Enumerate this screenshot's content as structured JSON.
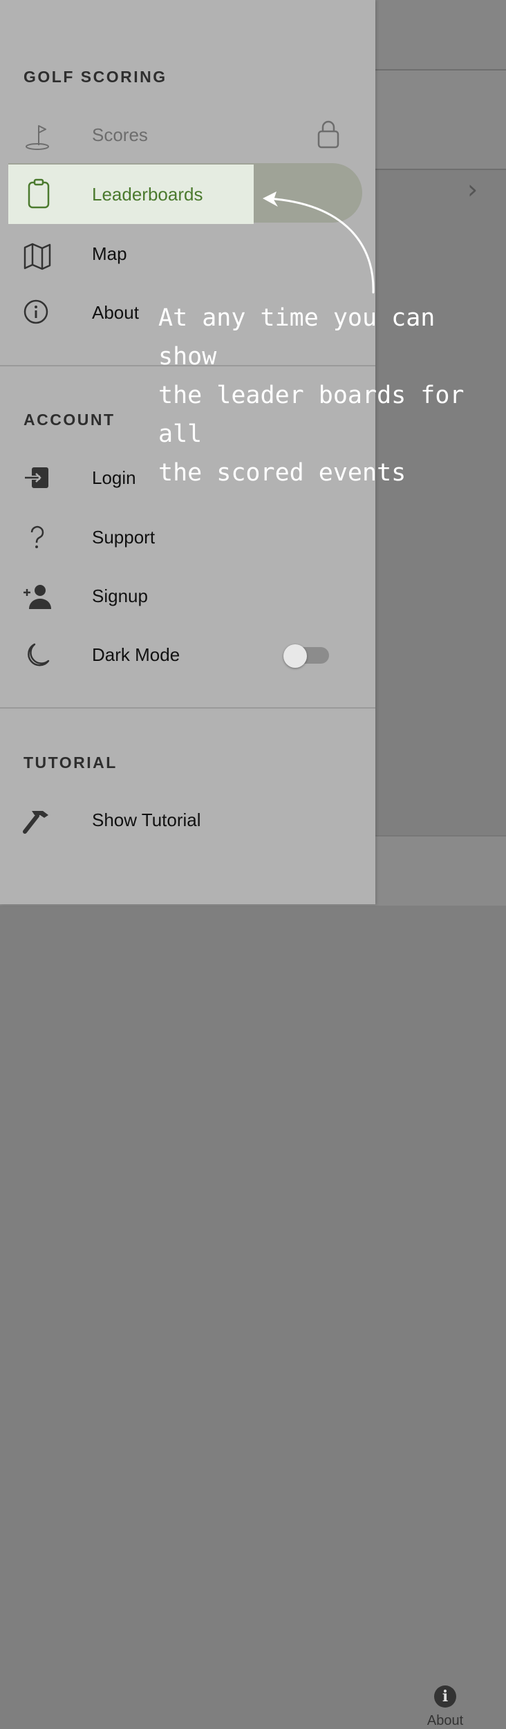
{
  "background_app": {
    "tabbar": {
      "about_label": "About"
    }
  },
  "drawer": {
    "sections": [
      {
        "title": "GOLF SCORING"
      },
      {
        "title": "ACCOUNT"
      },
      {
        "title": "TUTORIAL"
      }
    ],
    "golf_items": [
      {
        "label": "Scores",
        "icon": "flag-icon",
        "locked": true,
        "disabled": true
      },
      {
        "label": "Leaderboards",
        "icon": "clipboard-icon",
        "active": true
      },
      {
        "label": "Map",
        "icon": "map-icon"
      },
      {
        "label": "About",
        "icon": "info-icon"
      }
    ],
    "account_items": [
      {
        "label": "Login",
        "icon": "login-icon"
      },
      {
        "label": "Support",
        "icon": "help-icon"
      },
      {
        "label": "Signup",
        "icon": "add-person-icon"
      },
      {
        "label": "Dark Mode",
        "icon": "moon-icon",
        "toggle": false
      }
    ],
    "tutorial_items": [
      {
        "label": "Show Tutorial",
        "icon": "hammer-icon"
      }
    ]
  },
  "tutorial_overlay": {
    "lines": [
      "At any time you can show",
      "the leader boards for all",
      "the scored events"
    ]
  },
  "colors": {
    "active_text": "#4b7a2e",
    "active_highlight": "#e5ece1",
    "drawer_bg": "#b2b2b2"
  }
}
